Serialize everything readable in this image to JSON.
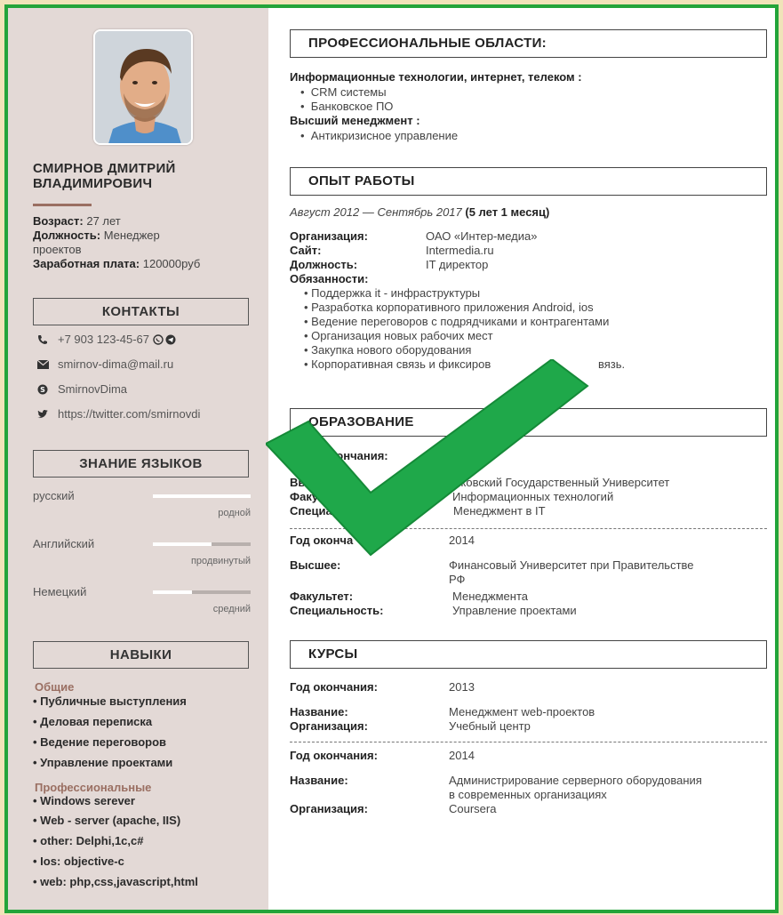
{
  "profile": {
    "name_line1": "СМИРНОВ ДМИТРИЙ",
    "name_line2": "ВЛАДИМИРОВИЧ",
    "age_label": "Возраст:",
    "age_value": "27 лет",
    "position_label": "Должность:",
    "position_value_1": "Менеджер",
    "position_value_2": "проектов",
    "salary_label": "Заработная плата:",
    "salary_value": "120000руб"
  },
  "contacts": {
    "title": "КОНТАКТЫ",
    "phone": "+7 903 123-45-67",
    "email": "smirnov-dima@mail.ru",
    "skype": "SmirnovDima",
    "twitter": "https://twitter.com/smirnovdi"
  },
  "languages": {
    "title": "ЗНАНИЕ ЯЗЫКОВ",
    "items": [
      {
        "name": "русский",
        "level": "родной",
        "fill": 1.0
      },
      {
        "name": "Английский",
        "level": "продвинутый",
        "fill": 0.6
      },
      {
        "name": "Немецкий",
        "level": "средний",
        "fill": 0.4
      }
    ]
  },
  "skills": {
    "title": "НАВЫКИ",
    "general_title": "Общие",
    "general": [
      "• Публичные выступления",
      "• Деловая переписка",
      "• Ведение переговоров",
      "• Управление проектами"
    ],
    "pro_title": "Профессиональные",
    "pro": [
      "• Windows serever",
      "• Web - server (apache, IIS)",
      "• other: Delphi,1c,c#",
      "• Ios: objective-c",
      "• web: php,css,javascript,html"
    ]
  },
  "areas": {
    "title": "ПРОФЕССИОНАЛЬНЫЕ ОБЛАСТИ:",
    "cat1": "Информационные технологии, интернет, телеком :",
    "cat1_items": [
      "CRM системы",
      "Банковское ПО"
    ],
    "cat2": "Высший менеджмент :",
    "cat2_items": [
      "Антикризисное управление"
    ]
  },
  "experience": {
    "title": "ОПЫТ РАБОТЫ",
    "period": "Август 2012 — Сентябрь 2017",
    "duration": "(5 лет 1 месяц)",
    "org_label": "Организация:",
    "org_value": "ОАО «Интер-медиа»",
    "site_label": "Сайт:",
    "site_value": "Intermedia.ru",
    "pos_label": "Должность:",
    "pos_value": "IT директор",
    "duties_label": "Обязанности:",
    "duties": [
      "• Поддержка it - инфраструктуры",
      "• Разработка корпоративного приложения Android, ios",
      "• Ведение переговоров с подрядчиками и контрагентами",
      "• Организация новых рабочих мест",
      "• Закупка нового оборудования",
      "• Корпоративная связь и фиксиров",
      "вязь."
    ]
  },
  "education": {
    "title": "ОБРАЗОВАНИЕ",
    "e1_year_label": "окончания:",
    "e1_high_label": "Вы",
    "e1_high_value": "сковский Государственный Университет",
    "e1_fac_label": "Факу",
    "e1_fac_value": "Информационных технологий",
    "e1_spec_label": "Специа",
    "e1_spec_value": "Менеджмент в IT",
    "e2_year_label": "Год оконча",
    "e2_year_value": "2014",
    "e2_high_label": "Высшее:",
    "e2_high_value_1": "Финансовый Университет при Правительстве",
    "e2_high_value_2": "РФ",
    "e2_fac_label": "Факультет:",
    "e2_fac_value": "Менеджмента",
    "e2_spec_label": "Специальность:",
    "e2_spec_value": "Управление проектами"
  },
  "courses": {
    "title": "КУРСЫ",
    "year_label": "Год окончания:",
    "name_label": "Название:",
    "org_label": "Организация:",
    "c1_year": "2013",
    "c1_name": "Менеджмент web-проектов",
    "c1_org": "Учебный центр",
    "c2_year": "2014",
    "c2_name_1": "Администрирование серверного оборудования",
    "c2_name_2": "в современных организациях",
    "c2_org": "Coursera"
  },
  "colors": {
    "accent": "#9a6f62",
    "frame": "#23a43a",
    "sidebar": "#e3d9d6",
    "check": "#1fa84a"
  }
}
